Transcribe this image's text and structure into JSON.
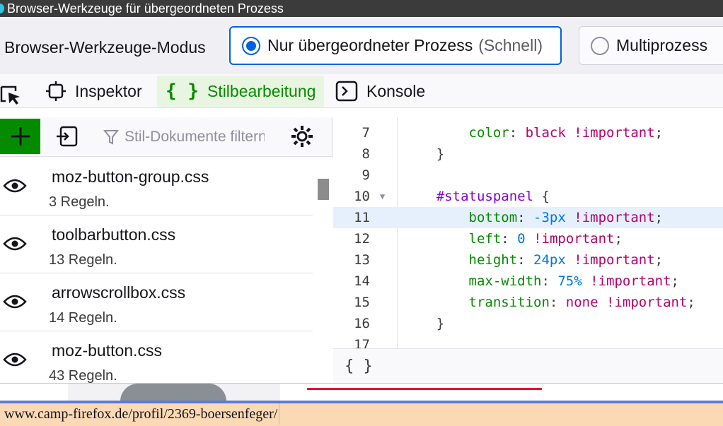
{
  "window": {
    "title": "Browser-Werkzeuge für übergeordneten Prozess"
  },
  "mode_bar": {
    "label": "Browser-Werkzeuge-Modus",
    "options": [
      {
        "label": "Nur übergeordneter Prozess",
        "hint": "(Schnell)",
        "selected": true
      },
      {
        "label": "Multiprozess",
        "selected": false
      }
    ]
  },
  "toolbox": {
    "tabs": [
      {
        "label": "Inspektor",
        "icon": "inspector-icon",
        "active": false
      },
      {
        "label": "Stilbearbeitung",
        "icon": "curly-braces-icon",
        "active": true
      },
      {
        "label": "Konsole",
        "icon": "console-icon",
        "active": false
      }
    ]
  },
  "style_editor": {
    "filter_placeholder": "Stil-Dokumente filtern",
    "stylesheets": [
      {
        "name": "moz-button-group.css",
        "rules": "3 Regeln."
      },
      {
        "name": "toolbarbutton.css",
        "rules": "13 Regeln."
      },
      {
        "name": "arrowscrollbox.css",
        "rules": "14 Regeln."
      },
      {
        "name": "moz-button.css",
        "rules": "43 Regeln."
      }
    ],
    "code_lines": [
      {
        "num": "7",
        "indent": "    ",
        "prop": "color",
        "val": "black",
        "type": "val",
        "imp": "!important"
      },
      {
        "num": "8",
        "text": "}"
      },
      {
        "num": "9",
        "text": ""
      },
      {
        "num": "10",
        "selector": "#statuspanel",
        "text": " {"
      },
      {
        "num": "11",
        "indent": "    ",
        "prop": "bottom",
        "val": "-3px",
        "type": "num",
        "imp": "!important",
        "highlight": true
      },
      {
        "num": "12",
        "indent": "    ",
        "prop": "left",
        "val": "0",
        "type": "num",
        "imp": "!important"
      },
      {
        "num": "13",
        "indent": "    ",
        "prop": "height",
        "val": "24px",
        "type": "num",
        "imp": "!important"
      },
      {
        "num": "14",
        "indent": "    ",
        "prop": "max-width",
        "val": "75%",
        "type": "num",
        "imp": "!important"
      },
      {
        "num": "15",
        "indent": "    ",
        "prop": "transition",
        "val": "none",
        "type": "val",
        "imp": "!important"
      },
      {
        "num": "16",
        "text": "}"
      },
      {
        "num": "17",
        "text": ""
      }
    ],
    "footer_label": "{ }"
  },
  "status_panel": {
    "url": "www.camp-firefox.de/profil/2369-boersenfeger/"
  },
  "colors": {
    "accent": "#0061e0",
    "active_tab": "#058b00",
    "status_bg": "#fbd9b5"
  }
}
